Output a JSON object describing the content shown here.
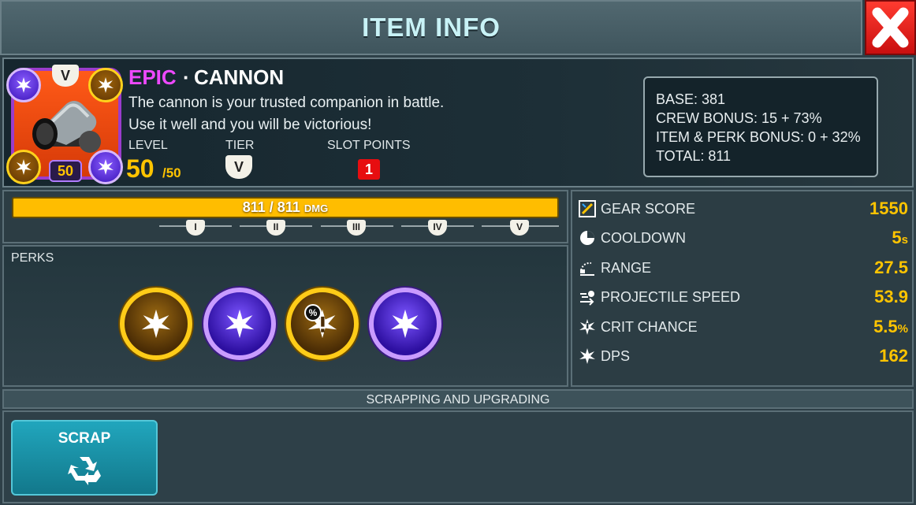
{
  "header": {
    "title": "ITEM INFO"
  },
  "item": {
    "rarity": "EPIC",
    "separator": "·",
    "name": "CANNON",
    "description_line1": "The cannon is your trusted companion in battle.",
    "description_line2": "Use it well and you will be victorious!",
    "level_label": "LEVEL",
    "level_value": "50",
    "level_max": "/50",
    "tier_label": "TIER",
    "tier_value": "V",
    "slot_points_label": "SLOT POINTS",
    "slot_points_value": "1",
    "badge_level": "50",
    "badge_tier": "V"
  },
  "damage_breakdown": {
    "base": "BASE: 381",
    "crew_bonus": "CREW BONUS: 15 + 73%",
    "item_perk_bonus": "ITEM & PERK BONUS: 0 + 32%",
    "total": "TOTAL: 811"
  },
  "damage_bar": {
    "value_text": "811 / 811",
    "unit": "DMG",
    "fill_fraction": 1.0,
    "tier_notches": [
      "I",
      "II",
      "III",
      "IV",
      "V"
    ]
  },
  "perks": {
    "label": "PERKS",
    "items": [
      {
        "style": "gold",
        "icon": "burst-icon"
      },
      {
        "style": "purple",
        "icon": "burst-icon"
      },
      {
        "style": "gold",
        "icon": "crit-burst-icon",
        "badge": "%"
      },
      {
        "style": "purple",
        "icon": "burst-icon"
      }
    ]
  },
  "stats": [
    {
      "icon": "gear-score-icon",
      "label": "GEAR SCORE",
      "value": "1550",
      "unit": ""
    },
    {
      "icon": "cooldown-icon",
      "label": "COOLDOWN",
      "value": "5",
      "unit": "s"
    },
    {
      "icon": "range-icon",
      "label": "RANGE",
      "value": "27.5",
      "unit": ""
    },
    {
      "icon": "projectile-speed-icon",
      "label": "PROJECTILE SPEED",
      "value": "53.9",
      "unit": ""
    },
    {
      "icon": "crit-chance-icon",
      "label": "CRIT CHANCE",
      "value": "5.5",
      "unit": "%"
    },
    {
      "icon": "dps-icon",
      "label": "DPS",
      "value": "162",
      "unit": ""
    }
  ],
  "scrapping": {
    "header": "SCRAPPING AND UPGRADING",
    "scrap_button": "SCRAP"
  },
  "colors": {
    "epic": "#ee49ff",
    "accent_gold": "#ffc400",
    "close_red": "#e0191b",
    "scrap_teal": "#1895ab"
  }
}
